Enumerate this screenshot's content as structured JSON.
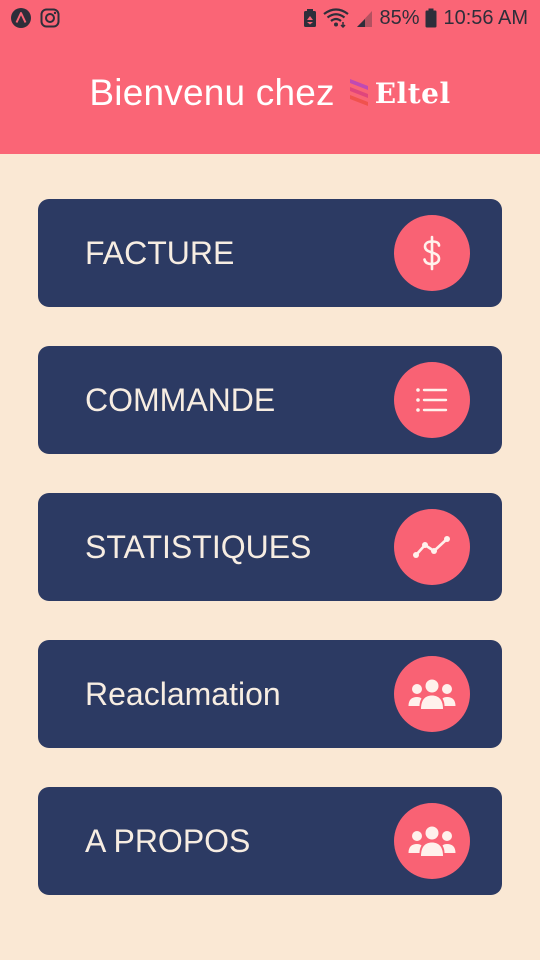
{
  "status_bar": {
    "battery_percent": "85%",
    "time": "10:56 AM",
    "icons_left": [
      "app-notification-icon",
      "instagram-icon"
    ],
    "icons_right": [
      "battery-saver-icon",
      "wifi-icon",
      "cellular-signal-icon",
      "battery-icon"
    ]
  },
  "header": {
    "welcome": "Bienvenu chez",
    "brand_name": "Eltel",
    "background_color": "#FA6576"
  },
  "menu": {
    "items": [
      {
        "label": "FACTURE",
        "icon": "dollar-icon"
      },
      {
        "label": "COMMANDE",
        "icon": "list-icon"
      },
      {
        "label": "STATISTIQUES",
        "icon": "trend-line-icon"
      },
      {
        "label": "Reaclamation",
        "icon": "users-icon"
      },
      {
        "label": "A PROPOS",
        "icon": "users-icon"
      }
    ],
    "card_color": "#2C3A63",
    "icon_circle_color": "#F96274"
  },
  "page_background": "#FAE8D4"
}
